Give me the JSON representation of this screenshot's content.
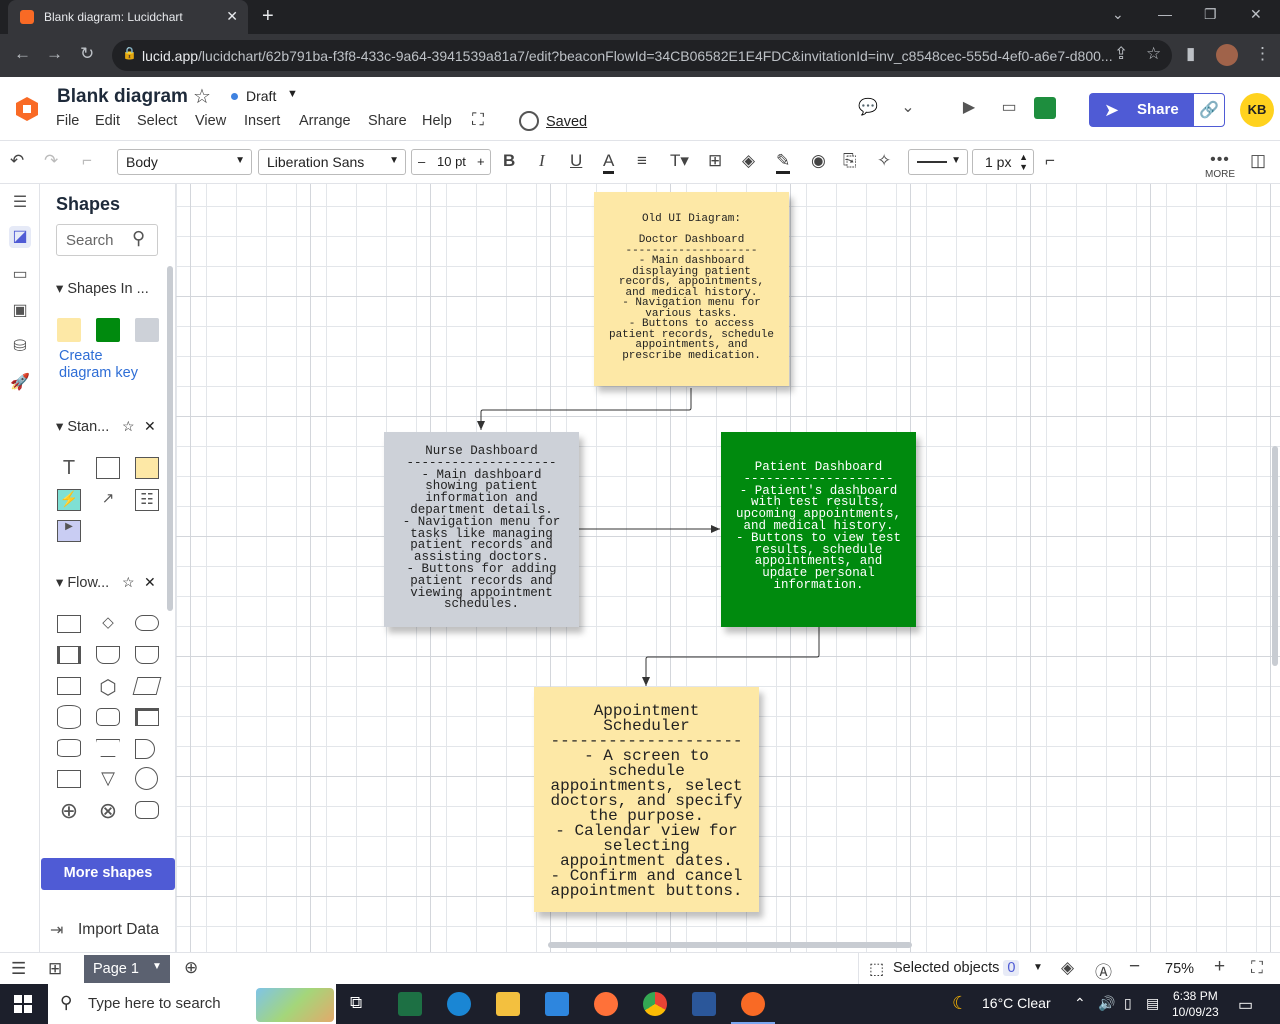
{
  "browser": {
    "tab_title": "Blank diagram: Lucidchart",
    "url_host": "lucid.app",
    "url_rest": "/lucidchart/62b791ba-f3f8-433c-9a64-3941539a81a7/edit?beaconFlowId=34CB06582E1E4FDC&invitationId=inv_c8548cec-555d-4ef0-a6e7-d800..."
  },
  "header": {
    "title": "Blank diagram",
    "status": "Draft",
    "saved": "Saved",
    "share": "Share",
    "avatar": "KB",
    "menu": [
      "File",
      "Edit",
      "Select",
      "View",
      "Insert",
      "Arrange",
      "Share",
      "Help"
    ]
  },
  "toolbar": {
    "style": "Body",
    "font": "Liberation Sans",
    "font_size": "10 pt",
    "line_width": "1 px",
    "more": "MORE"
  },
  "panel": {
    "title": "Shapes",
    "search_placeholder": "Search",
    "sec1": "Shapes In ...",
    "diagram_key": "Create diagram key",
    "sec2": "Stan...",
    "sec3": "Flow...",
    "more_shapes": "More shapes",
    "import": "Import Data",
    "swatch_colors": [
      "#fde8a6",
      "#008a0e",
      "#cdd1d8"
    ]
  },
  "notes": {
    "old": {
      "text": "Old UI Diagram:\n\nDoctor Dashboard\n--------------------\n- Main dashboard\ndisplaying patient\nrecords, appointments,\nand medical history.\n- Navigation menu for\nvarious tasks.\n- Buttons to access\npatient records, schedule\nappointments, and\nprescribe medication.",
      "color": "#fde8a6"
    },
    "nurse": {
      "text": "Nurse Dashboard\n--------------------\n- Main dashboard\nshowing patient\ninformation and\ndepartment details.\n- Navigation menu for\ntasks like managing\npatient records and\nassisting doctors.\n- Buttons for adding\npatient records and\nviewing appointment\nschedules.",
      "color": "#cdd1d8"
    },
    "patient": {
      "text": "Patient Dashboard\n--------------------\n- Patient's dashboard\nwith test results,\nupcoming appointments,\nand medical history.\n- Buttons to view test\nresults, schedule\nappointments, and\nupdate personal\ninformation.",
      "color": "#008a0e"
    },
    "appt": {
      "text": "Appointment\nScheduler\n--------------------\n- A screen to\nschedule\nappointments, select\ndoctors, and specify\nthe purpose.\n- Calendar view for\nselecting\nappointment dates.\n- Confirm and cancel\nappointment buttons.",
      "color": "#fde8a6"
    }
  },
  "bottom": {
    "page": "Page 1",
    "selected_label": "Selected objects",
    "selected_count": "0",
    "zoom": "75%"
  },
  "taskbar": {
    "search": "Type here to search",
    "weather": "16°C  Clear",
    "time": "6:38 PM",
    "date": "10/09/23"
  }
}
